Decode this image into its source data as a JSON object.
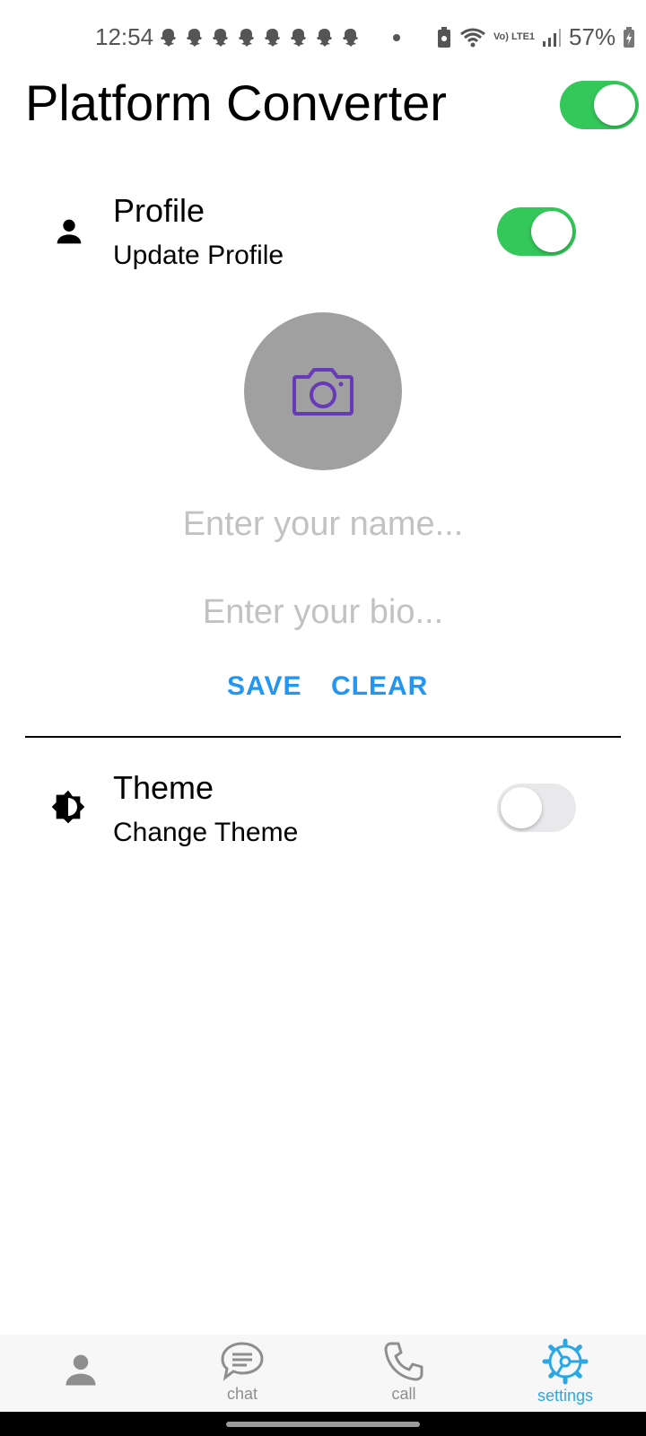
{
  "status_bar": {
    "time": "12:54",
    "battery": "57%",
    "network_label": "Vo) LTE1"
  },
  "header": {
    "title": "Platform Converter",
    "toggle_on": true
  },
  "profile_section": {
    "icon": "person-icon",
    "title": "Profile",
    "subtitle": "Update Profile",
    "toggle_on": true,
    "avatar_icon": "camera-icon",
    "name_placeholder": "Enter your name...",
    "bio_placeholder": "Enter your bio...",
    "save_label": "SAVE",
    "clear_label": "CLEAR"
  },
  "theme_section": {
    "icon": "brightness-icon",
    "title": "Theme",
    "subtitle": "Change Theme",
    "toggle_on": false
  },
  "bottom_nav": {
    "items": [
      {
        "label": "",
        "icon": "person-icon"
      },
      {
        "label": "chat",
        "icon": "chat-icon"
      },
      {
        "label": "call",
        "icon": "phone-icon"
      },
      {
        "label": "settings",
        "icon": "settings-icon"
      }
    ],
    "active_index": 3
  },
  "colors": {
    "accent": "#2196f3",
    "toggle_on": "#34c759",
    "avatar_bg": "#a0a0a0",
    "camera": "#673ab7",
    "nav_active": "#2aa8e6"
  }
}
